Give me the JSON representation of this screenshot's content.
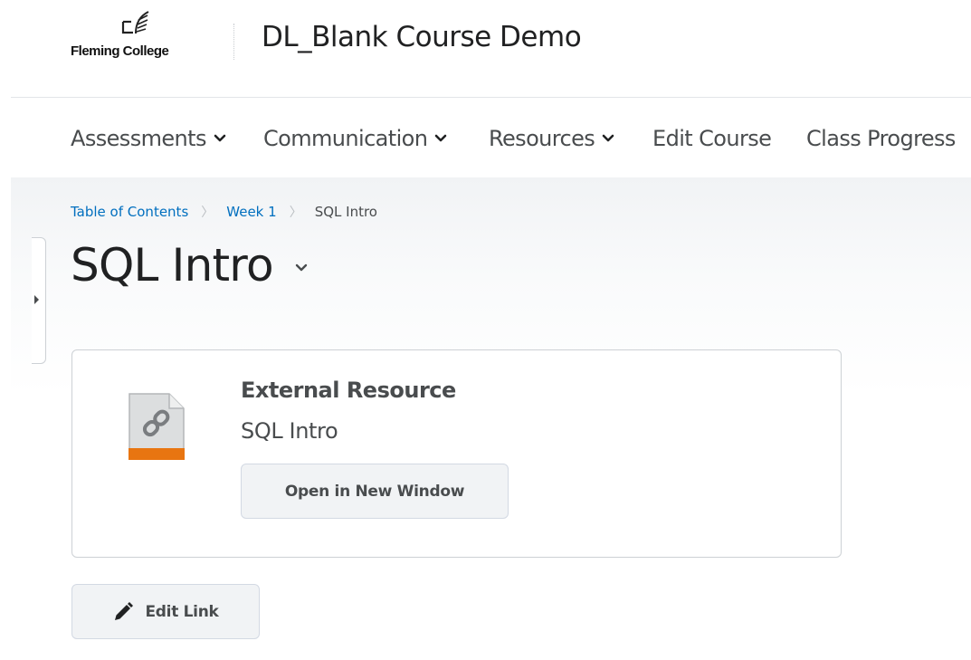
{
  "header": {
    "logo_text": "Fleming College",
    "course_title": "DL_Blank Course Demo"
  },
  "nav": {
    "items": [
      {
        "label": "Assessments",
        "has_dropdown": true
      },
      {
        "label": "Communication",
        "has_dropdown": true
      },
      {
        "label": "Resources",
        "has_dropdown": true
      },
      {
        "label": "Edit Course",
        "has_dropdown": false
      },
      {
        "label": "Class Progress",
        "has_dropdown": false
      }
    ]
  },
  "breadcrumb": {
    "items": [
      "Table of Contents",
      "Week 1"
    ],
    "current": "SQL Intro"
  },
  "page": {
    "title": "SQL Intro"
  },
  "resource": {
    "type_label": "External Resource",
    "name": "SQL Intro",
    "icon": "link-file-icon",
    "open_button_label": "Open in New Window"
  },
  "actions": {
    "edit_link_label": "Edit Link",
    "edit_icon": "pencil-icon"
  },
  "colors": {
    "link": "#006fbf",
    "accent": "#e87511",
    "text": "#494c4e",
    "title": "#202122"
  }
}
